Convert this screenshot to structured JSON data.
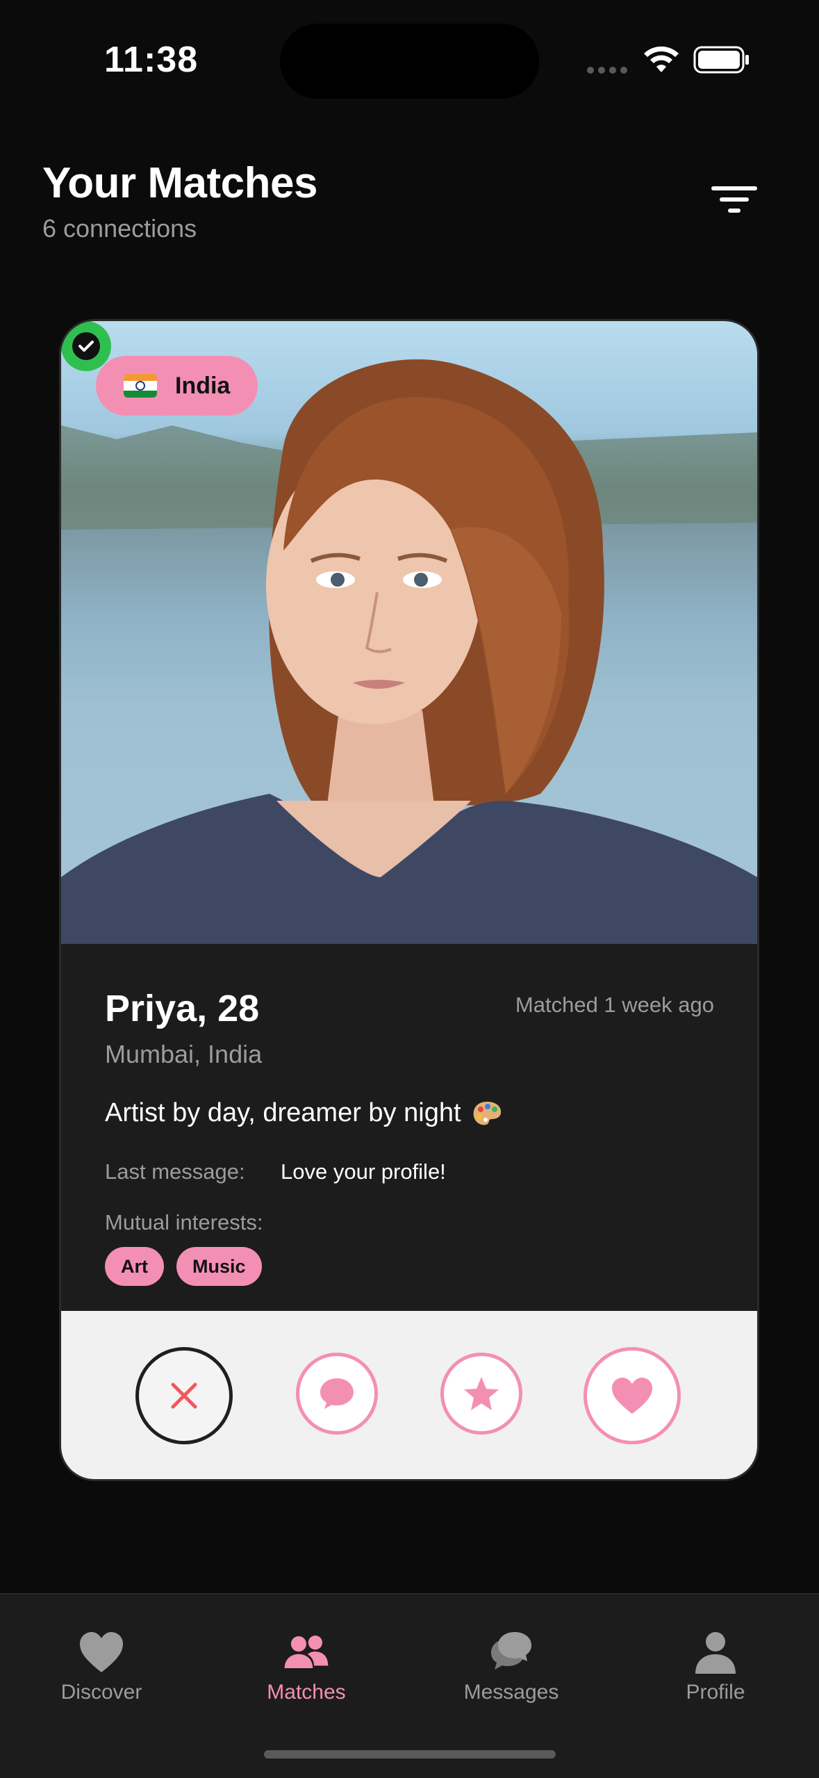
{
  "status_bar": {
    "time": "11:38"
  },
  "header": {
    "title": "Your Matches",
    "subtitle": "6 connections"
  },
  "card": {
    "country": "India",
    "name_age": "Priya, 28",
    "matched": "Matched 1 week ago",
    "location": "Mumbai, India",
    "bio": "Artist by day, dreamer by night",
    "last_message_label": "Last message:",
    "last_message": "Love your profile!",
    "interests_label": "Mutual interests:",
    "interests": [
      "Art",
      "Music"
    ]
  },
  "tabs": [
    {
      "label": "Discover",
      "icon": "heart-icon",
      "active": false
    },
    {
      "label": "Matches",
      "icon": "people-icon",
      "active": true
    },
    {
      "label": "Messages",
      "icon": "chat-bubbles-icon",
      "active": false
    },
    {
      "label": "Profile",
      "icon": "person-icon",
      "active": false
    }
  ],
  "colors": {
    "accent": "#f48fb4",
    "background": "#0b0b0b",
    "card": "#1c1c1c",
    "verified": "#2fbf4f",
    "pass": "#f0575b"
  }
}
